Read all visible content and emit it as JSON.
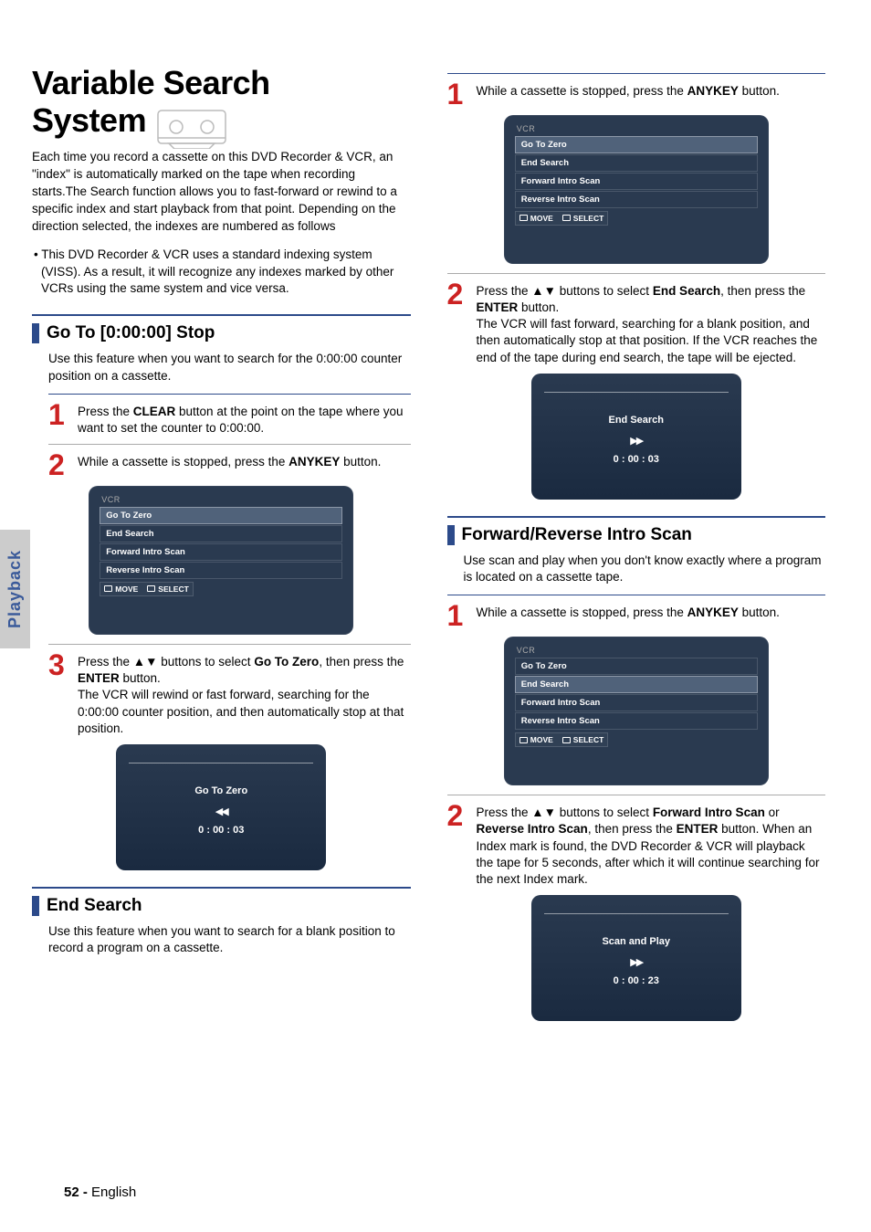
{
  "sidetab": "Playback",
  "footer_page": "52 -",
  "footer_lang": "English",
  "main_title_l1": "Variable Search",
  "main_title_l2": "System",
  "intro_p1": "Each time you record a cassette on this DVD Recorder & VCR, an \"index\" is automatically marked on the tape when recording starts.The Search function allows you to fast-forward or rewind to a specific index and start playback from that point. Depending on the direction selected, the indexes are numbered as follows",
  "intro_bullet": "• This DVD Recorder & VCR uses a standard indexing system (VISS). As a result, it will recognize any indexes marked by other VCRs using the same system and vice versa.",
  "sections": {
    "goto": {
      "title": "Go To [0:00:00] Stop",
      "desc": "Use this feature when you want to search for the 0:00:00 counter position on a cassette.",
      "step1_a": "Press the ",
      "step1_b": "CLEAR",
      "step1_c": " button at the point on the tape where you want to set the counter to 0:00:00.",
      "step2_a": "While a cassette is stopped, press the ",
      "step2_b": "ANYKEY",
      "step2_c": " button.",
      "step3_a": "Press the ▲▼ buttons to select ",
      "step3_b": "Go To Zero",
      "step3_c": ", then press the ",
      "step3_d": "ENTER",
      "step3_e": " button.",
      "step3_f": "The VCR will rewind or fast forward, searching for the 0:00:00 counter position, and then automatically stop at that position."
    },
    "endsearch": {
      "title": "End Search",
      "desc": "Use this feature when you want to search for a blank position to record a program on a cassette.",
      "step1_a": "While a cassette is stopped, press the ",
      "step1_b": "ANYKEY",
      "step1_c": " button.",
      "step2_a": "Press the ▲▼ buttons to select ",
      "step2_b": "End Search",
      "step2_c": ", then press the ",
      "step2_d": "ENTER",
      "step2_e": " button.",
      "step2_f": "The VCR will fast forward, searching for a blank position, and then automatically stop at that position. If the VCR reaches the end of the tape during end search, the tape will be ejected."
    },
    "intro_scan": {
      "title": "Forward/Reverse Intro Scan",
      "desc": "Use scan and play when you don't know exactly where a program is located on a cassette tape.",
      "step1_a": "While a cassette is stopped, press the ",
      "step1_b": "ANYKEY",
      "step1_c": " button.",
      "step2_a": "Press the ▲▼ buttons to select ",
      "step2_b": "Forward Intro Scan",
      "step2_c": " or ",
      "step2_d": "Reverse Intro Scan",
      "step2_e": ", then press the ",
      "step2_f": "ENTER",
      "step2_g": " button. When an Index mark is found, the DVD Recorder & VCR will playback the tape for 5 seconds, after which it will continue searching for the next Index mark."
    }
  },
  "osd_menu": {
    "label": "VCR",
    "items": [
      "Go To Zero",
      "End Search",
      "Forward Intro Scan",
      "Reverse Intro Scan"
    ],
    "move": "MOVE",
    "select": "SELECT"
  },
  "osd_status": {
    "goto": {
      "title": "Go To Zero",
      "icon": "◀◀",
      "time": "0 : 00 : 03"
    },
    "end": {
      "title": "End Search",
      "icon": "▶▶",
      "time": "0 : 00 : 03"
    },
    "scan": {
      "title": "Scan and Play",
      "icon": "▶▶",
      "time": "0 : 00 : 23"
    }
  }
}
